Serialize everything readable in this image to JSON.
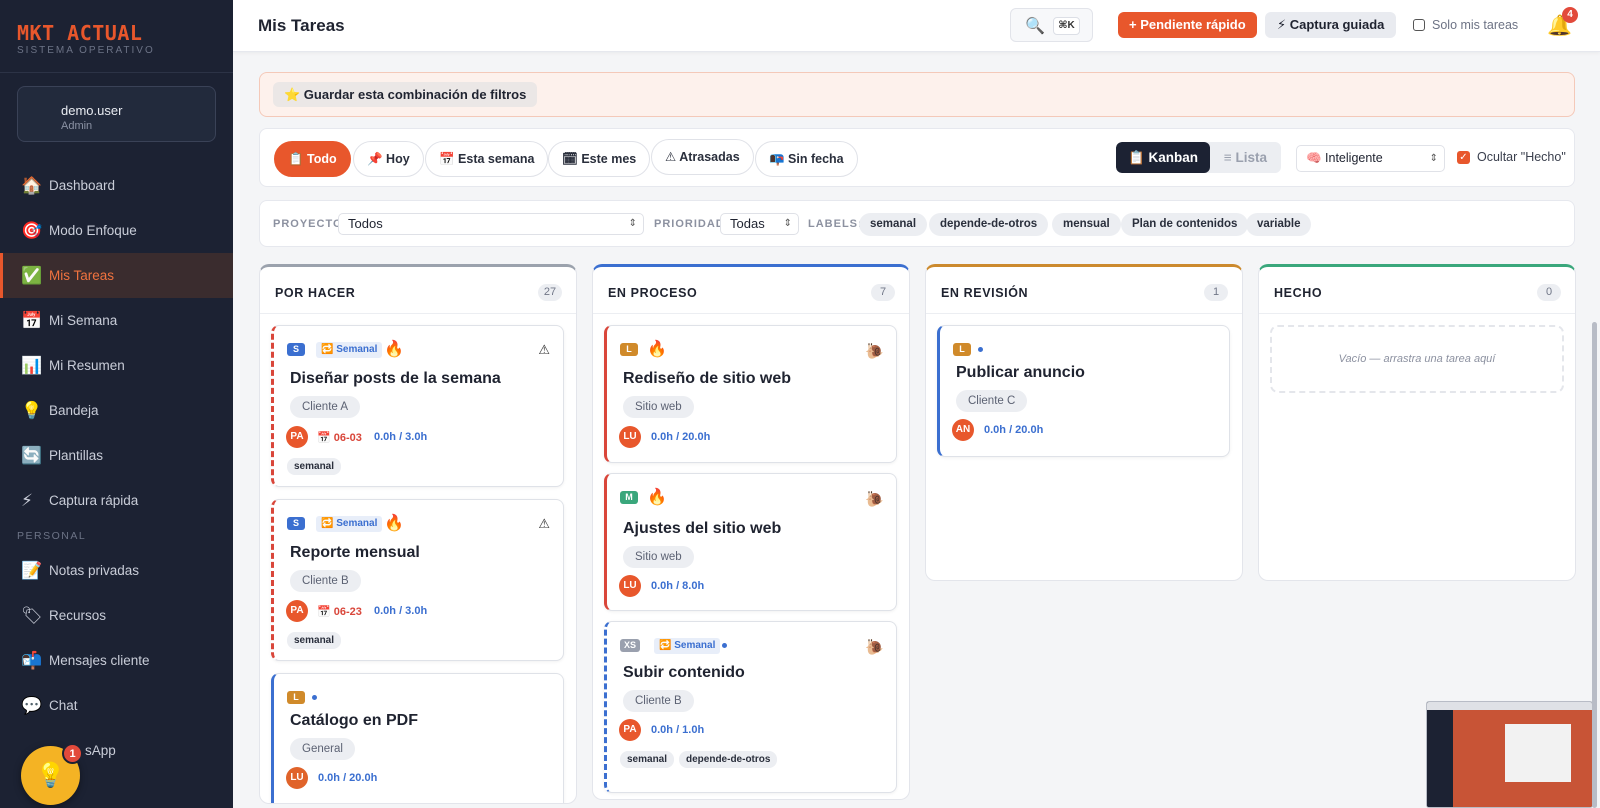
{
  "brand": {
    "title": "MKT ACTUAL",
    "subtitle": "SISTEMA OPERATIVO"
  },
  "user": {
    "name": "demo.user",
    "role": "Admin"
  },
  "sidebar": {
    "items": [
      {
        "label": "Dashboard",
        "icon": "🏠"
      },
      {
        "label": "Modo Enfoque",
        "icon": "🎯"
      },
      {
        "label": "Mis Tareas",
        "icon": "✅"
      },
      {
        "label": "Mi Semana",
        "icon": "📅"
      },
      {
        "label": "Mi Resumen",
        "icon": "📊"
      },
      {
        "label": "Bandeja",
        "icon": "💡"
      },
      {
        "label": "Plantillas",
        "icon": "🔄"
      },
      {
        "label": "Captura rápida",
        "icon": "⚡"
      }
    ],
    "section_personal": "PERSONAL",
    "personal_items": [
      {
        "label": "Notas privadas",
        "icon": "📝"
      },
      {
        "label": "Recursos",
        "icon": "🏷"
      },
      {
        "label": "Mensajes cliente",
        "icon": "📬"
      },
      {
        "label": "Chat",
        "icon": "💬"
      },
      {
        "label": "sApp",
        "icon": ""
      }
    ],
    "help_badge": "1"
  },
  "topbar": {
    "title": "Mis Tareas",
    "search_kbd": "⌘K",
    "quick_pending": "+ Pendiente rápido",
    "guided_capture": "⚡ Captura guiada",
    "only_mine": "Solo mis tareas",
    "notifications": "4"
  },
  "banner": {
    "save_filters": "⭐ Guardar esta combinación de filtros"
  },
  "time_filters": [
    {
      "label": "📋 Todo"
    },
    {
      "label": "📌 Hoy"
    },
    {
      "label": "📅 Esta semana"
    },
    {
      "label": "🗓 Este mes"
    },
    {
      "label": "⚠ Atrasadas"
    },
    {
      "label": "📭 Sin fecha"
    }
  ],
  "view": {
    "kanban": "📋 Kanban",
    "list": "≡ Lista",
    "mode": "🧠 Inteligente",
    "hide_done": "Ocultar \"Hecho\""
  },
  "filters": {
    "project_label": "PROYECTO",
    "project_value": "Todos",
    "priority_label": "PRIORIDAD",
    "priority_value": "Todas",
    "labels_label": "LABELS:",
    "labels": [
      "semanal",
      "depende-de-otros",
      "mensual",
      "Plan de contenidos",
      "variable"
    ]
  },
  "columns": {
    "todo": {
      "title": "POR HACER",
      "count": "27",
      "cards": [
        {
          "size": "S",
          "recur": "🔁 Semanal",
          "title": "Diseñar posts de la semana",
          "client": "Cliente A",
          "avatar": "PA",
          "due": "📅 06-03",
          "hours": "0.0h / 3.0h",
          "tag": "semanal"
        },
        {
          "size": "S",
          "recur": "🔁 Semanal",
          "title": "Reporte mensual",
          "client": "Cliente B",
          "avatar": "PA",
          "due": "📅 06-23",
          "hours": "0.0h / 3.0h",
          "tag": "semanal"
        },
        {
          "size": "L",
          "title": "Catálogo en PDF",
          "client": "General",
          "avatar": "LU",
          "hours": "0.0h / 20.0h"
        }
      ]
    },
    "progress": {
      "title": "EN PROCESO",
      "count": "7",
      "cards": [
        {
          "size": "L",
          "title": "Rediseño de sitio web",
          "client": "Sitio web",
          "avatar": "LU",
          "hours": "0.0h / 20.0h"
        },
        {
          "size": "M",
          "title": "Ajustes del sitio web",
          "client": "Sitio web",
          "avatar": "LU",
          "hours": "0.0h / 8.0h"
        },
        {
          "size": "XS",
          "recur": "🔁 Semanal",
          "title": "Subir contenido",
          "client": "Cliente B",
          "avatar": "PA",
          "hours": "0.0h / 1.0h",
          "tags": [
            "semanal",
            "depende-de-otros"
          ]
        }
      ]
    },
    "review": {
      "title": "EN REVISIÓN",
      "count": "1",
      "cards": [
        {
          "size": "L",
          "title": "Publicar anuncio",
          "client": "Cliente C",
          "avatar": "AN",
          "hours": "0.0h / 20.0h"
        }
      ]
    },
    "done": {
      "title": "HECHO",
      "count": "0",
      "empty": "Vacío — arrastra una tarea aquí"
    }
  }
}
